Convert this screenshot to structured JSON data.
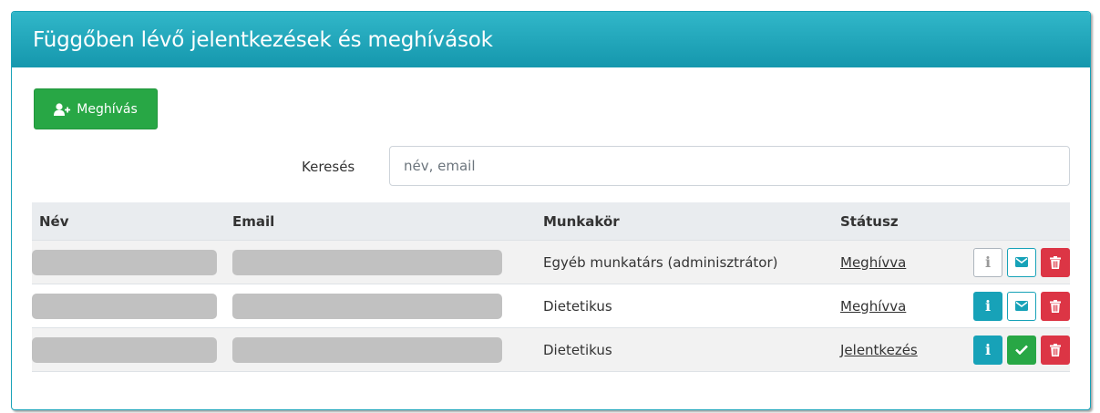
{
  "panel": {
    "title": "Függőben lévő jelentkezések és meghívások"
  },
  "toolbar": {
    "invite_label": "Meghívás",
    "invite_icon": "user-plus-icon"
  },
  "search": {
    "label": "Keresés",
    "placeholder": "név, email",
    "value": ""
  },
  "table": {
    "columns": [
      "Név",
      "Email",
      "Munkakör",
      "Státusz"
    ],
    "rows": [
      {
        "name": "",
        "email": "",
        "role": "Egyéb munkatárs (adminisztrátor)",
        "status": "Meghívva",
        "actions": [
          "info-disabled",
          "mail",
          "delete"
        ]
      },
      {
        "name": "",
        "email": "",
        "role": "Dietetikus",
        "status": "Meghívva",
        "actions": [
          "info",
          "mail",
          "delete"
        ]
      },
      {
        "name": "",
        "email": "",
        "role": "Dietetikus",
        "status": "Jelentkezés",
        "actions": [
          "info",
          "accept",
          "delete"
        ]
      }
    ]
  },
  "colors": {
    "header": "#1fa7bd",
    "success": "#28a745",
    "info": "#17a2b8",
    "danger": "#dc3545",
    "redacted": "#c1c1c1"
  }
}
